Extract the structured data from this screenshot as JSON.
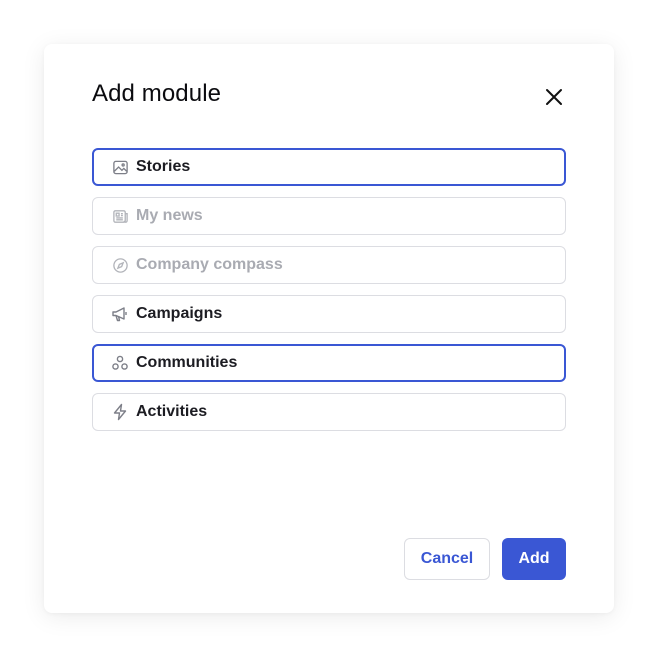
{
  "dialog": {
    "title": "Add module",
    "close_icon": "close-icon"
  },
  "modules": [
    {
      "label": "Stories",
      "icon": "image-icon",
      "state": "selected"
    },
    {
      "label": "My news",
      "icon": "newspaper-icon",
      "state": "disabled"
    },
    {
      "label": "Company compass",
      "icon": "compass-icon",
      "state": "disabled"
    },
    {
      "label": "Campaigns",
      "icon": "megaphone-icon",
      "state": "default"
    },
    {
      "label": "Communities",
      "icon": "communities-icon",
      "state": "selected"
    },
    {
      "label": "Activities",
      "icon": "lightning-icon",
      "state": "default"
    }
  ],
  "footer": {
    "cancel_label": "Cancel",
    "add_label": "Add"
  },
  "colors": {
    "accent": "#3a57d4",
    "border": "#dcdde2",
    "disabled_text": "#a9abb2"
  }
}
